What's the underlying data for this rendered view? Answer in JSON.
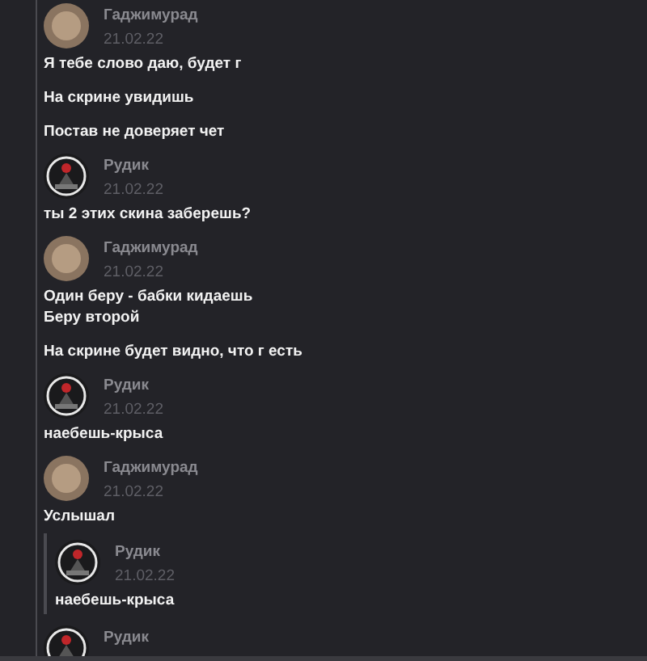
{
  "messages": [
    {
      "author": "Гаджимурад",
      "kind": "photo",
      "date": "21.02.22",
      "paragraphs": [
        "Я тебе слово даю, будет г",
        "На скрине увидишь",
        "Постав не доверяет чет"
      ]
    },
    {
      "author": "Рудик",
      "kind": "emblem",
      "date": "21.02.22",
      "paragraphs": [
        "ты 2 этих скина заберешь?"
      ]
    },
    {
      "author": "Гаджимурад",
      "kind": "photo",
      "date": "21.02.22",
      "paragraphs": [
        "Один беру - бабки кидаешь\nБеру второй",
        "На скрине будет видно, что г есть"
      ]
    },
    {
      "author": "Рудик",
      "kind": "emblem",
      "date": "21.02.22",
      "paragraphs": [
        "наебешь-крыса"
      ]
    },
    {
      "author": "Гаджимурад",
      "kind": "photo",
      "date": "21.02.22",
      "paragraphs": [
        "Услышал"
      ],
      "quote": {
        "author": "Рудик",
        "kind": "emblem",
        "date": "21.02.22",
        "paragraphs": [
          "наебешь-крыса"
        ]
      }
    },
    {
      "author": "Рудик",
      "kind": "emblem"
    }
  ]
}
